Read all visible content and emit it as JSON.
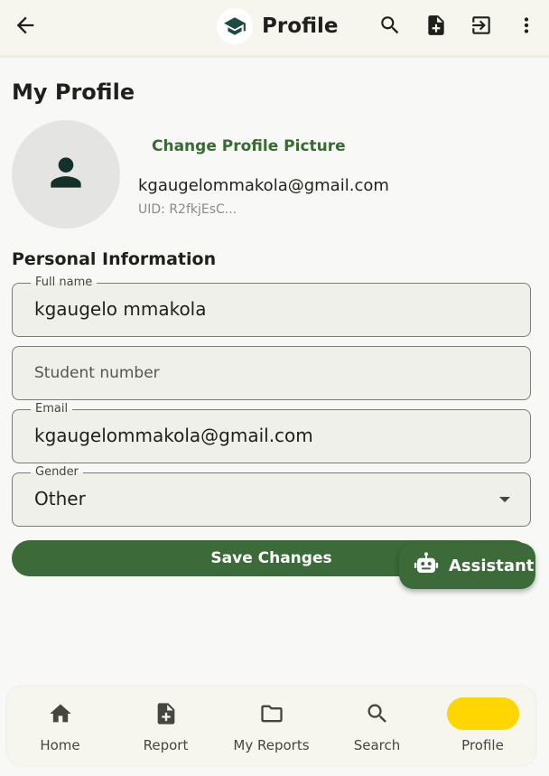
{
  "appbar": {
    "title": "Profile",
    "icons": [
      "back-arrow-icon",
      "graduation-cap-icon",
      "search-icon",
      "add-document-icon",
      "logout-icon",
      "more-vert-icon"
    ]
  },
  "page": {
    "title": "My Profile"
  },
  "profile": {
    "change_picture_label": "Change Profile Picture",
    "email": "kgaugelommakola@gmail.com",
    "uid": "UID: R2fkjEsC..."
  },
  "personal_info": {
    "section_title": "Personal Information",
    "full_name": {
      "label": "Full name",
      "value": "kgaugelo mmakola"
    },
    "student_number": {
      "placeholder": "Student number",
      "value": ""
    },
    "email": {
      "label": "Email",
      "value": "kgaugelommakola@gmail.com"
    },
    "gender": {
      "label": "Gender",
      "value": "Other"
    }
  },
  "actions": {
    "save_label": "Save Changes",
    "assistant_label": "Assistant"
  },
  "bottom_nav": {
    "items": [
      {
        "label": "Home",
        "icon": "home-icon",
        "active": false
      },
      {
        "label": "Report",
        "icon": "add-document-icon",
        "active": false
      },
      {
        "label": "My Reports",
        "icon": "folder-icon",
        "active": false
      },
      {
        "label": "Search",
        "icon": "search-icon",
        "active": false
      },
      {
        "label": "Profile",
        "icon": "person-icon",
        "active": true
      }
    ]
  },
  "colors": {
    "primary": "#3c6a38",
    "accent_text": "#3a6a34",
    "active_indicator": "#ffd600",
    "background": "#f8f8f6",
    "appbar": "#f6f6ee"
  }
}
